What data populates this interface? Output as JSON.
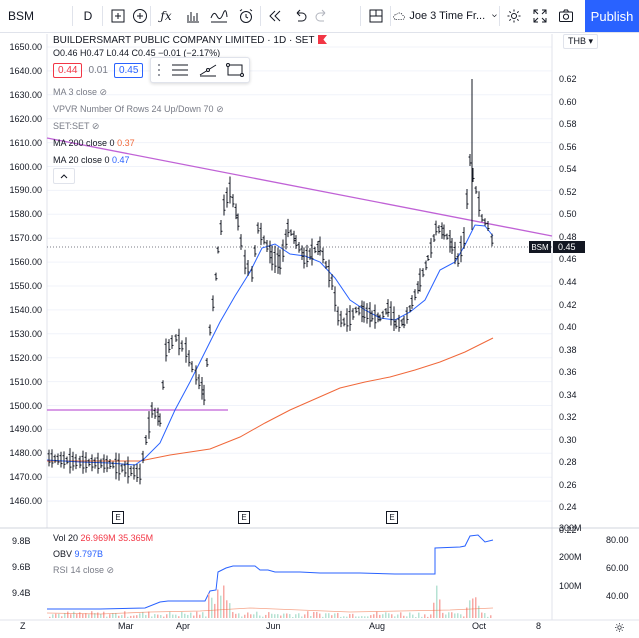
{
  "topbar": {
    "symbol": "BSM",
    "interval": "D",
    "layout_name": "Joe 3 Time Fr...",
    "publish_label": "Publish"
  },
  "header": {
    "title": "BUILDERSMART PUBLIC COMPANY LIMITED · 1D · SET",
    "ohlc": "O0.46 H0.47 L0.44 C0.45 −0.01 (−2.17%)",
    "bid": "0.44",
    "spread": "0.01",
    "ask": "0.45"
  },
  "legends": {
    "ma3": "MA 3 close",
    "vpvr": "VPVR Number Of Rows 24 Up/Down 70",
    "set": "SET:SET",
    "ma200": "MA 200 close 0",
    "ma200_value": "0.37",
    "ma20": "MA 20 close 0",
    "ma20_value": "0.47"
  },
  "price_badge": {
    "symbol": "BSM",
    "value": "0.45"
  },
  "currency": "THB",
  "left_axis_labels": [
    "1650.00",
    "1640.00",
    "1630.00",
    "1620.00",
    "1610.00",
    "1600.00",
    "1590.00",
    "1580.00",
    "1570.00",
    "1560.00",
    "1550.00",
    "1540.00",
    "1530.00",
    "1520.00",
    "1510.00",
    "1500.00",
    "1490.00",
    "1480.00",
    "1470.00",
    "1460.00"
  ],
  "right_axis_labels": [
    "0.62",
    "0.60",
    "0.58",
    "0.56",
    "0.54",
    "0.52",
    "0.50",
    "0.48",
    "0.46",
    "0.44",
    "0.42",
    "0.40",
    "0.38",
    "0.36",
    "0.34",
    "0.32",
    "0.30",
    "0.28",
    "0.26",
    "0.24",
    "0.22"
  ],
  "time_labels": [
    "Z",
    "Mar",
    "Apr",
    "Jun",
    "Aug",
    "Oct",
    "8"
  ],
  "earnings_badge": "E",
  "lower_pane": {
    "vol": "Vol 20",
    "vol_a": "26.969M",
    "vol_b": "35.365M",
    "obv": "OBV",
    "obv_value": "9.797B",
    "rsi": "RSI 14 close",
    "left_axis": [
      "9.8B",
      "9.6B",
      "9.4B"
    ],
    "mid_axis": [
      "300M",
      "200M",
      "100M"
    ],
    "right_axis": [
      "80.00",
      "60.00",
      "40.00"
    ]
  },
  "colors": {
    "trendline": "#c062d6",
    "ma200": "#f0683a",
    "ma20": "#2962ff",
    "bars": "#131722",
    "publish": "#2962ff",
    "sell": "#f23645",
    "buy": "#2962ff"
  },
  "chart_data": {
    "type": "ohlc",
    "y_left_range": [
      1455,
      1655
    ],
    "y_right_range": [
      0.215,
      0.625
    ],
    "x_labels": [
      "Mar",
      "Apr",
      "Jun",
      "Aug",
      "Oct"
    ],
    "series": [
      {
        "name": "BSM",
        "last": 0.45
      },
      {
        "name": "MA 20 close",
        "last": 0.47
      },
      {
        "name": "MA 200 close",
        "last": 0.37
      }
    ]
  }
}
